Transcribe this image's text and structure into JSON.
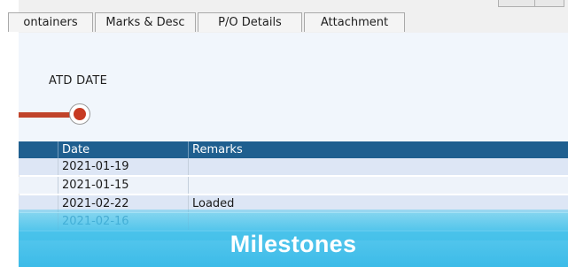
{
  "tabs": [
    {
      "label": "ontainers"
    },
    {
      "label": "Marks & Desc"
    },
    {
      "label": "P/O Details"
    },
    {
      "label": "Attachment"
    }
  ],
  "milestone": {
    "label": "ATD DATE"
  },
  "grid": {
    "columns": {
      "date": "Date",
      "remarks": "Remarks"
    },
    "rows": [
      {
        "date": "2021-01-19",
        "remarks": ""
      },
      {
        "date": "2021-01-15",
        "remarks": ""
      },
      {
        "date": "2021-02-22",
        "remarks": "Loaded"
      },
      {
        "date": "2021-02-16",
        "remarks": ""
      }
    ]
  },
  "overlay": {
    "title": "Milestones"
  },
  "colors": {
    "header": "#1f5f8f",
    "timeline": "#c0442a",
    "overlay": "#3cbbe8"
  }
}
